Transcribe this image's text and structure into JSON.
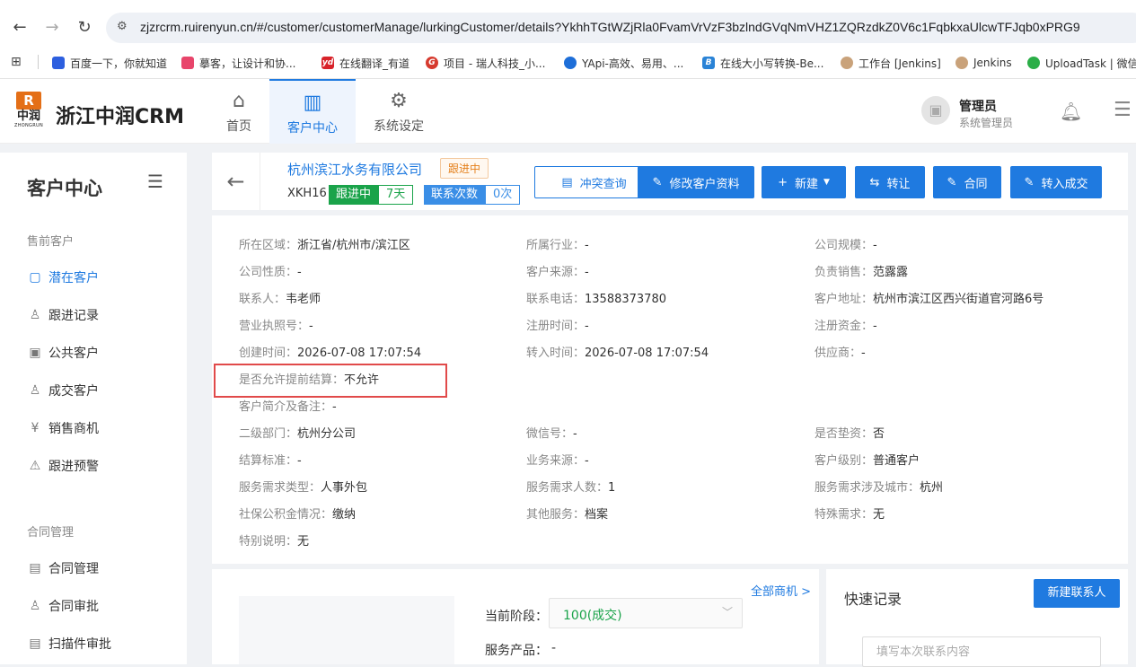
{
  "browser": {
    "url": "zjzrcrm.ruirenyun.cn/#/customer/customerManage/lurkingCustomer/details?YkhhTGtWZjRla0FvamVrVzF3bzlndGVqNmVHZ1ZQRzdkZ0V6c1FqbkxaUlcwTFJqb0xPRG9",
    "bookmarks": [
      "百度一下，你就知道",
      "摹客，让设计和协...",
      "在线翻译_有道",
      "项目 - 瑞人科技_小...",
      "YApi-高效、易用、...",
      "在线大小写转换-Be...",
      "工作台 [Jenkins]",
      "Jenkins",
      "UploadTask | 微信"
    ]
  },
  "header": {
    "logo_mark": "R",
    "logo_cn": "中润",
    "logo_en": "ZHONGRUN",
    "app_title": "浙江中润CRM",
    "nav": [
      {
        "label": "首页"
      },
      {
        "label": "客户中心"
      },
      {
        "label": "系统设定"
      }
    ],
    "user_name": "管理员",
    "user_role": "系统管理员"
  },
  "sidebar": {
    "title": "客户中心",
    "groups": [
      {
        "label": "售前客户",
        "items": [
          "潜在客户",
          "跟进记录",
          "公共客户",
          "成交客户",
          "销售商机",
          "跟进预警"
        ]
      },
      {
        "label": "合同管理",
        "items": [
          "合同管理",
          "合同审批",
          "扫描件审批"
        ]
      }
    ]
  },
  "customer": {
    "name": "杭州滨江水务有限公司",
    "status": "跟进中",
    "code": "XKH16",
    "follow_label": "跟进中",
    "follow_days": "7天",
    "contact_label": "联系次数",
    "contact_count": "0次"
  },
  "actions": {
    "conflict": "冲突查询",
    "edit": "修改客户资料",
    "new": "新建",
    "transfer": "转让",
    "contract": "合同",
    "deal": "转入成交"
  },
  "fields": [
    {
      "k": "所在区域：",
      "v": "浙江省/杭州市/滨江区"
    },
    {
      "k": "所属行业：",
      "v": "-"
    },
    {
      "k": "公司规模：",
      "v": "-"
    },
    {
      "k": "公司性质：",
      "v": "-"
    },
    {
      "k": "客户来源：",
      "v": "-"
    },
    {
      "k": "负责销售：",
      "v": "范露露"
    },
    {
      "k": "联系人：",
      "v": "韦老师"
    },
    {
      "k": "联系电话：",
      "v": "13588373780"
    },
    {
      "k": "客户地址：",
      "v": "杭州市滨江区西兴街道官河路6号"
    },
    {
      "k": "营业执照号：",
      "v": "-"
    },
    {
      "k": "注册时间：",
      "v": "-"
    },
    {
      "k": "注册资金：",
      "v": "-"
    },
    {
      "k": "创建时间：",
      "v": "2026-07-08 17:07:54"
    },
    {
      "k": "转入时间：",
      "v": "2026-07-08 17:07:54"
    },
    {
      "k": "供应商：",
      "v": "-"
    },
    {
      "k": "是否允许提前结算：",
      "v": "不允许"
    },
    {
      "k": "客户简介及备注：",
      "v": "-"
    },
    {
      "k": "二级部门：",
      "v": "杭州分公司"
    },
    {
      "k": "微信号：",
      "v": "-"
    },
    {
      "k": "是否垫资：",
      "v": "否"
    },
    {
      "k": "结算标准：",
      "v": "-"
    },
    {
      "k": "业务来源：",
      "v": "-"
    },
    {
      "k": "客户级别：",
      "v": "普通客户"
    },
    {
      "k": "服务需求类型：",
      "v": "人事外包"
    },
    {
      "k": "服务需求人数：",
      "v": "1"
    },
    {
      "k": "服务需求涉及城市：",
      "v": "杭州"
    },
    {
      "k": "社保公积金情况：",
      "v": "缴纳"
    },
    {
      "k": "其他服务：",
      "v": "档案"
    },
    {
      "k": "特殊需求：",
      "v": "无"
    },
    {
      "k": "特别说明：",
      "v": "无"
    }
  ],
  "opportunity": {
    "all_link": "全部商机 >",
    "stage_label": "当前阶段：",
    "stage_value": "100(成交)",
    "product_label": "服务产品：",
    "product_value": "-"
  },
  "quick_record": {
    "title": "快速记录",
    "new_contact": "新建联系人",
    "placeholder": "填写本次联系内容"
  },
  "colors": {
    "primary": "#1f7ae0",
    "success": "#1aa34a",
    "warning": "#e4801c",
    "highlight": "#e14a4a"
  }
}
